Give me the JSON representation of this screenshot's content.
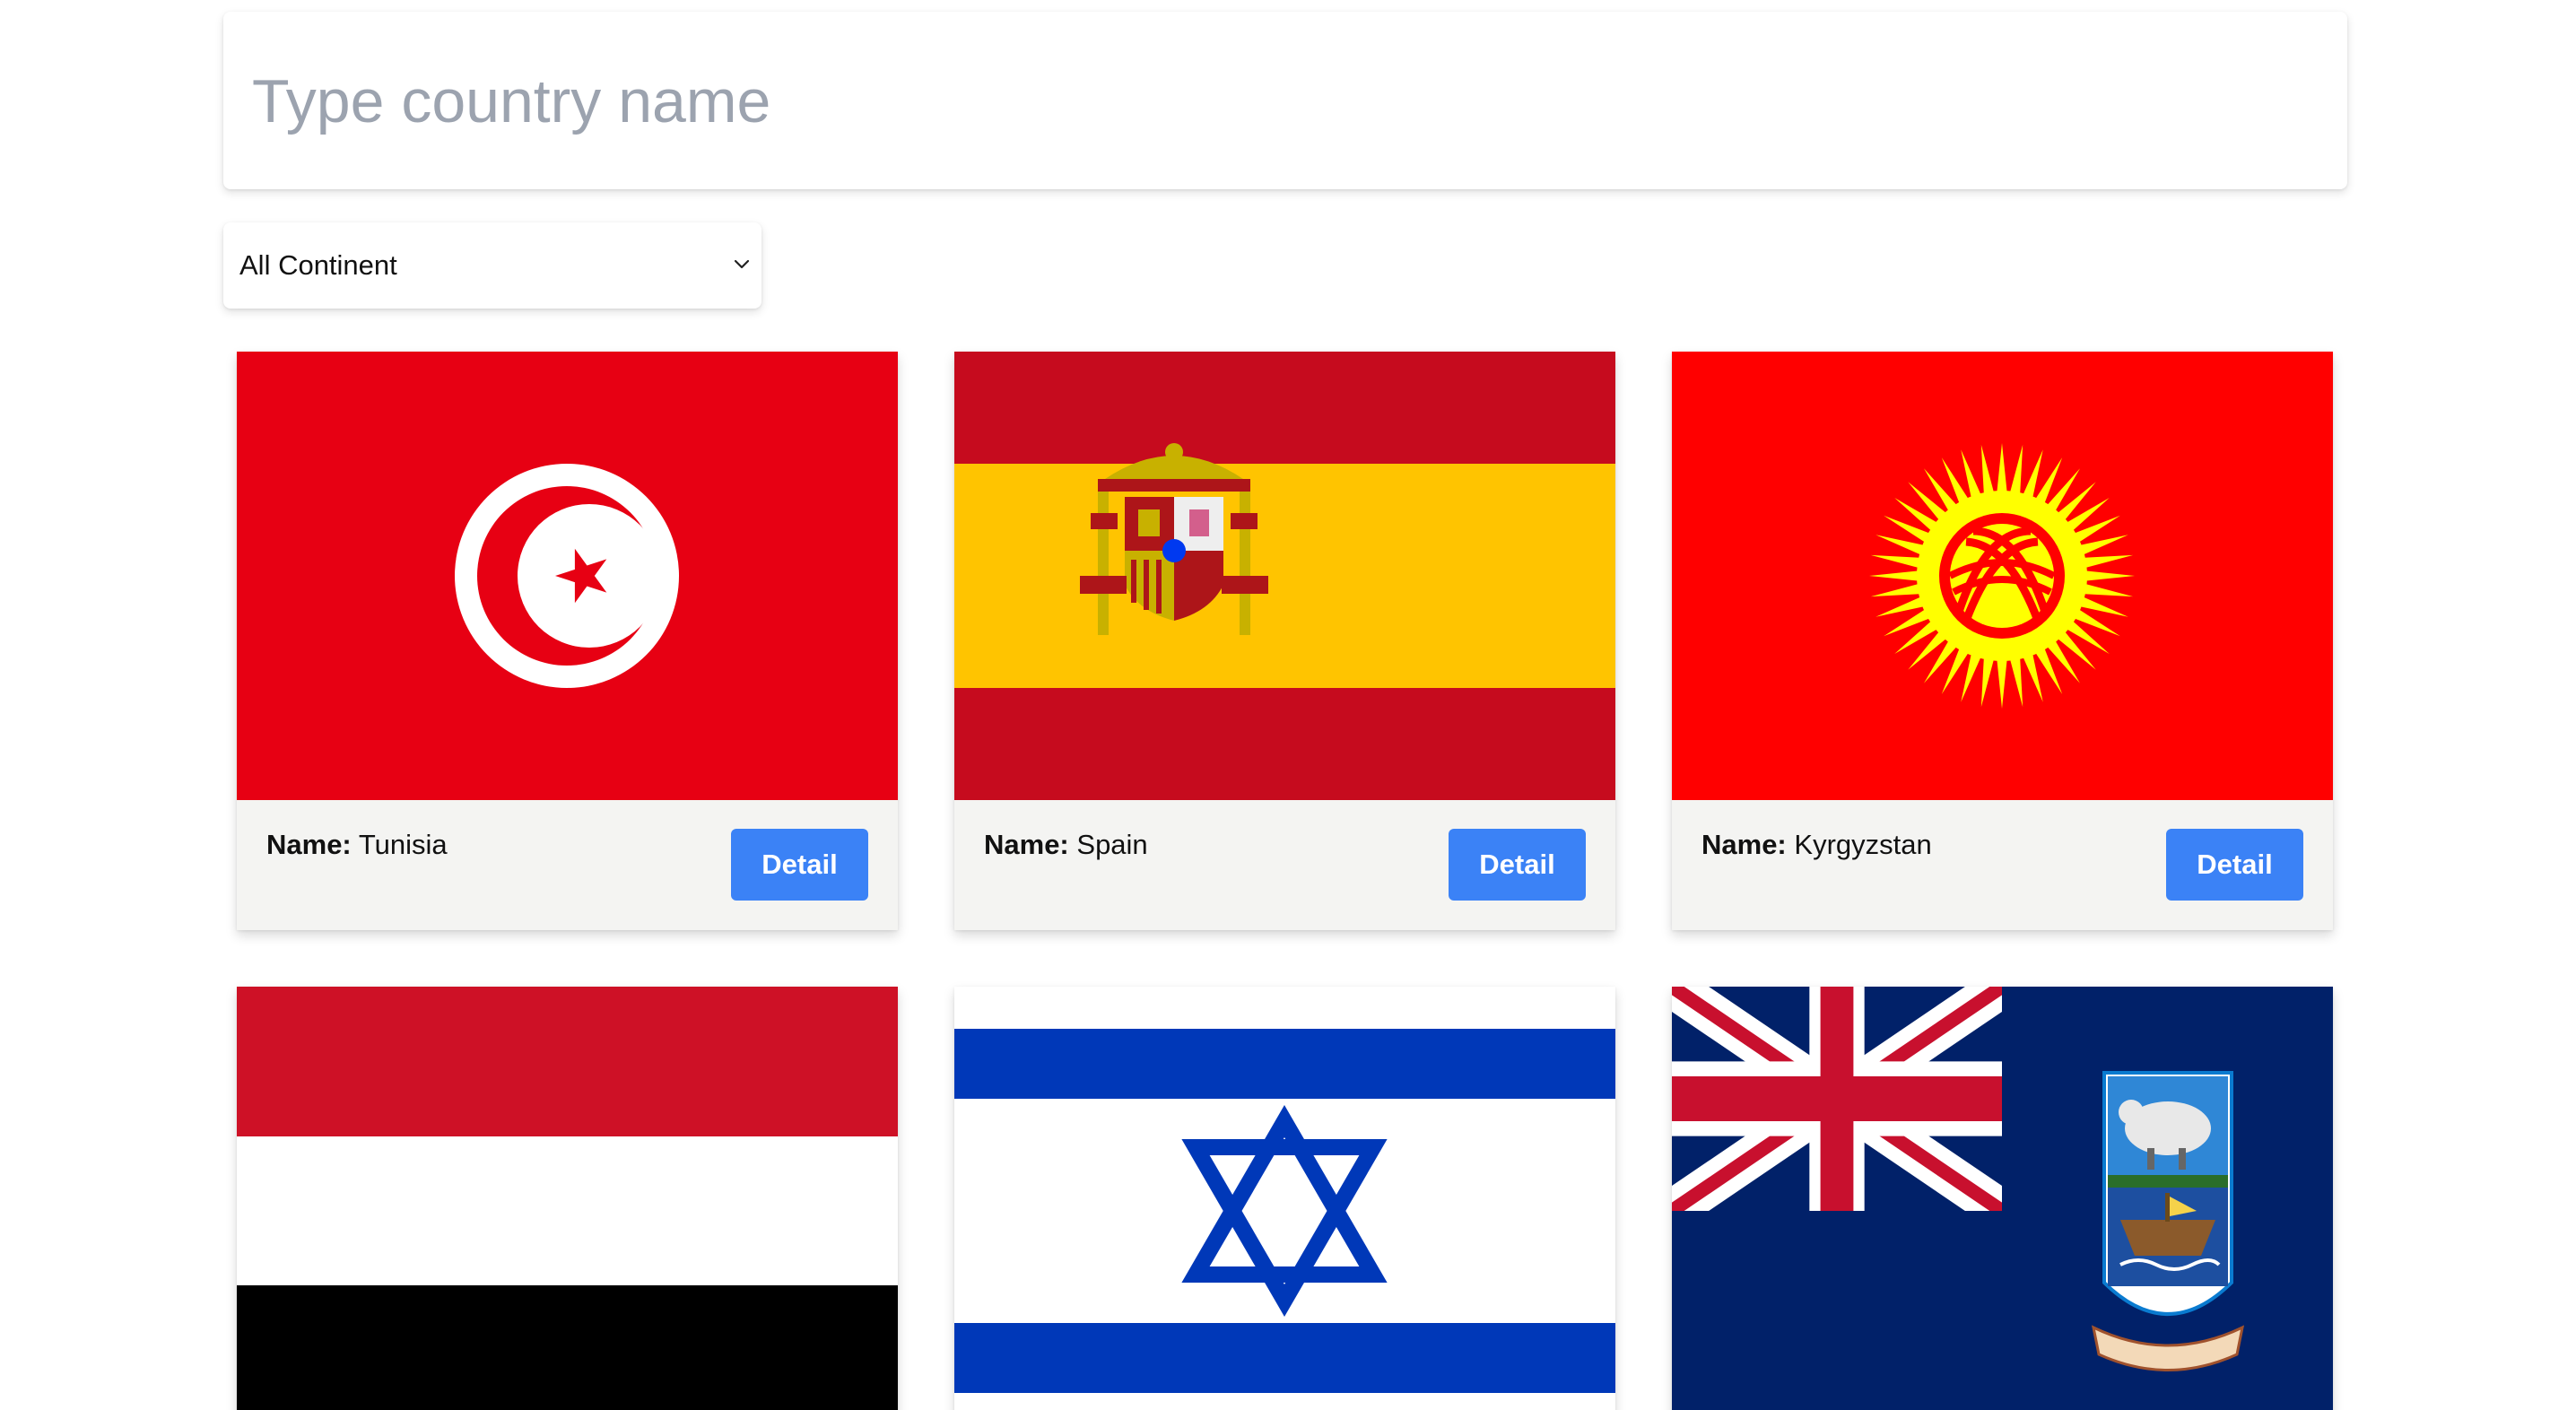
{
  "search": {
    "placeholder": "Type country name",
    "value": ""
  },
  "filter": {
    "selected": "All Continent"
  },
  "cards": [
    {
      "name_label": "Name:",
      "name": "Tunisia",
      "button": "Detail",
      "flag": "tunisia-flag"
    },
    {
      "name_label": "Name:",
      "name": "Spain",
      "button": "Detail",
      "flag": "spain-flag"
    },
    {
      "name_label": "Name:",
      "name": "Kyrgyzstan",
      "button": "Detail",
      "flag": "kyrgyzstan-flag"
    },
    {
      "flag": "yemen-flag"
    },
    {
      "flag": "israel-flag"
    },
    {
      "flag": "falkland-islands-flag"
    }
  ],
  "colors": {
    "button": "#3b82f6",
    "card_footer": "#f4f4f2",
    "placeholder": "#9ca3af"
  }
}
